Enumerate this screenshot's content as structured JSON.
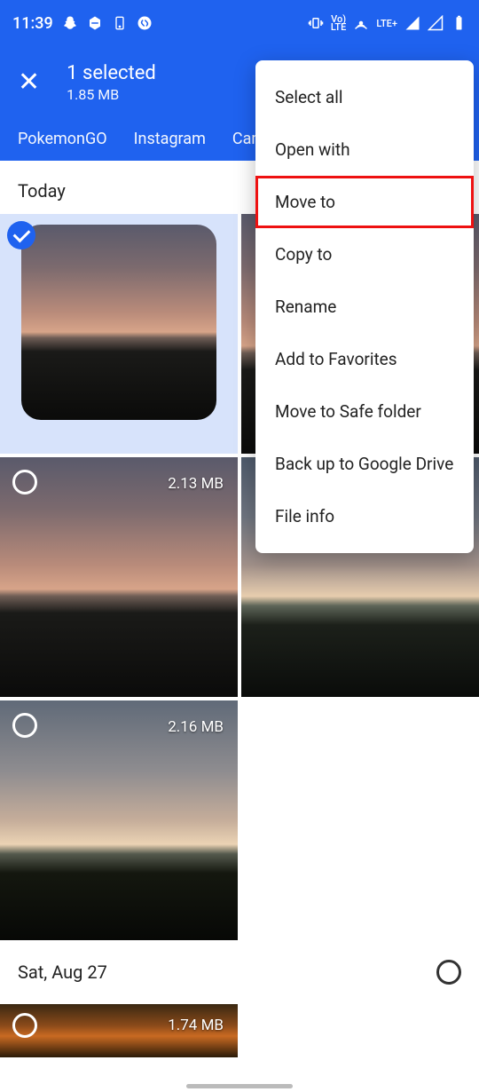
{
  "statusbar": {
    "time": "11:39",
    "lte_label": "LTE+",
    "vo_label": "Vo)\nLTE"
  },
  "header": {
    "title": "1 selected",
    "subtitle": "1.85 MB"
  },
  "tabs": [
    "PokemonGO",
    "Instagram",
    "Camera"
  ],
  "sections": {
    "today": "Today",
    "sat": "Sat, Aug 27"
  },
  "sizes": {
    "img3": "2.13 MB",
    "img5": "2.16 MB",
    "img7": "1.74 MB"
  },
  "menu": {
    "select_all": "Select all",
    "open_with": "Open with",
    "move_to": "Move to",
    "copy_to": "Copy to",
    "rename": "Rename",
    "favorites": "Add to Favorites",
    "safe": "Move to Safe folder",
    "backup": "Back up to Google Drive",
    "info": "File info"
  }
}
